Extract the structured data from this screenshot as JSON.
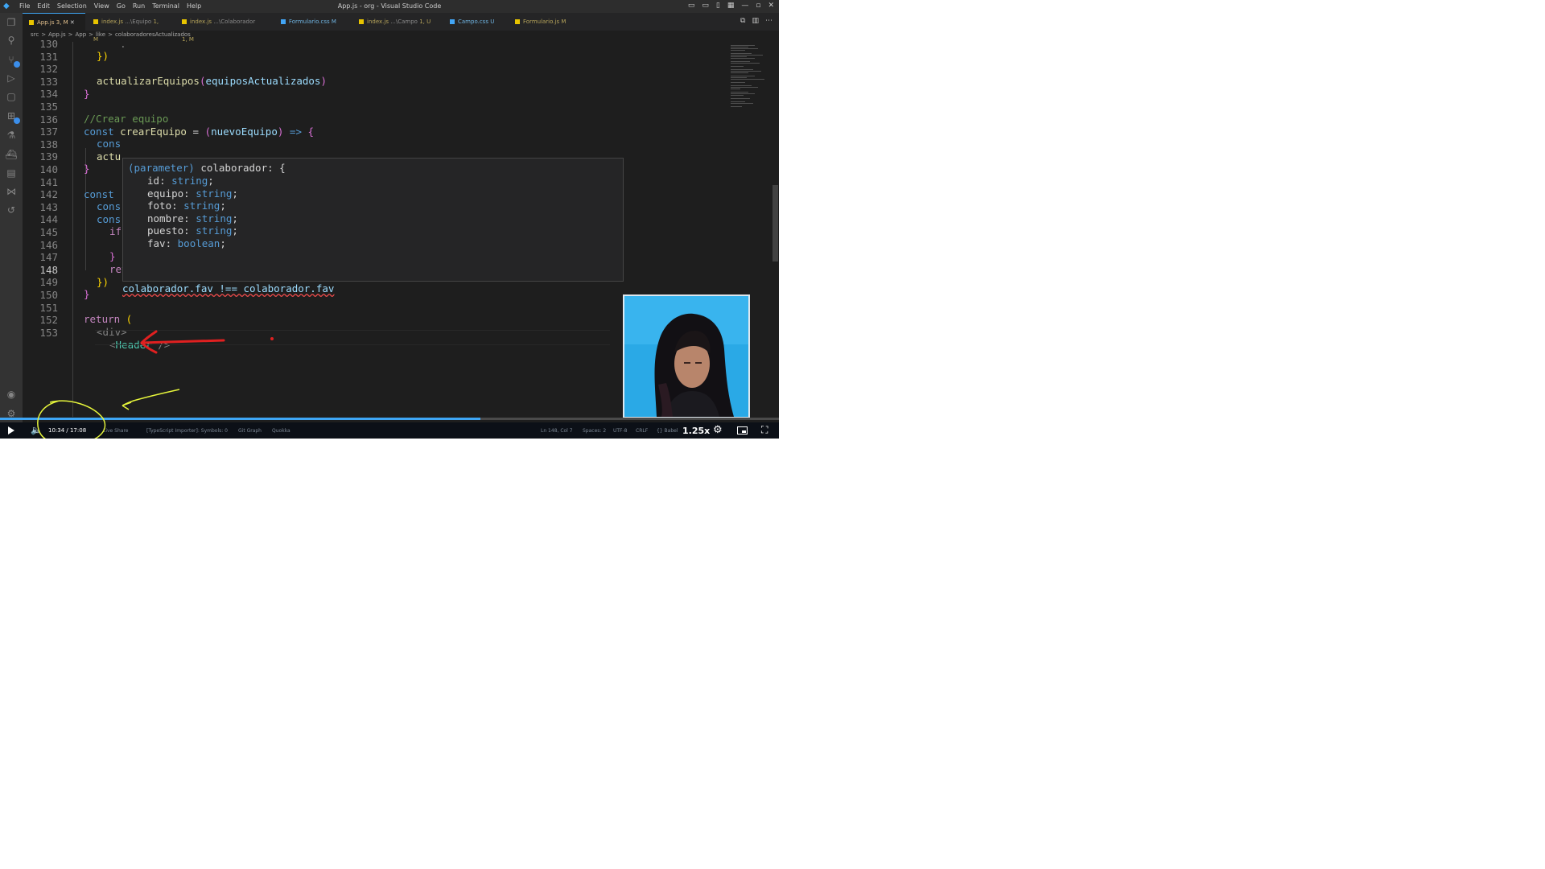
{
  "window": {
    "title": "App.js - org - Visual Studio Code",
    "menu": [
      "File",
      "Edit",
      "Selection",
      "View",
      "Go",
      "Run",
      "Terminal",
      "Help"
    ],
    "controls": [
      "▭",
      "▭",
      "▯",
      "▦",
      "—",
      "▫",
      "✕"
    ]
  },
  "tabs": [
    {
      "name": "App.js",
      "status": "3, M",
      "active": true,
      "close": "✕"
    },
    {
      "name": "index.js",
      "path": "...\\Equipo",
      "status": "1, M"
    },
    {
      "name": "index.js",
      "path": "...\\Colaborador",
      "status": "1, M"
    },
    {
      "name": "Formulario.css",
      "status": "M"
    },
    {
      "name": "index.js",
      "path": "...\\Campo",
      "status": "1, U"
    },
    {
      "name": "Campo.css",
      "status": "U"
    },
    {
      "name": "Formulario.js",
      "status": "M"
    }
  ],
  "breadcrumb": [
    "src",
    ">",
    "App.js",
    ">",
    "App",
    ">",
    "like",
    ">",
    "colaboradoresActualizados"
  ],
  "line_numbers": [
    "130",
    "131",
    "132",
    "133",
    "134",
    "135",
    "136",
    "137",
    "138",
    "139",
    "140",
    "141",
    "142",
    "143",
    "144",
    "145",
    "146",
    "147",
    "148",
    "149",
    "150",
    "151",
    "152",
    "153"
  ],
  "current_line": "148",
  "code": {
    "l131": "})",
    "l132_fn": "actualizarEquipos",
    "l132_paren_open": "(",
    "l132_arg": "equiposActualizados",
    "l132_paren_close": ")",
    "l133": "}",
    "l135": "//Crear equipo",
    "l136_kw": "const",
    "l136_fn": "crearEquipo",
    "l136_eq": " = ",
    "l136_p1": "(",
    "l136_arg": "nuevoEquipo",
    "l136_p2": ")",
    "l136_arrow": " => ",
    "l136_brace": "{",
    "l137": "cons",
    "l138": "actu",
    "l139": "}",
    "l141": "const",
    "l142": "cons",
    "l143": "cons",
    "l144": "if",
    "l146": "}",
    "l147_kw": "return",
    "l147_var": "colaborador",
    "l148": "})",
    "l149": "}",
    "l151_kw": "return",
    "l151_p": " (",
    "l152": "<div>",
    "l153_open": "<",
    "l153_tag": "Header",
    "l153_close": " />"
  },
  "error_line": "colaborador.fav !== colaborador.fav",
  "hover": {
    "header_kw": "(parameter)",
    "header_rest": " colaborador: {",
    "fields": [
      {
        "name": "id",
        "type": "string"
      },
      {
        "name": "equipo",
        "type": "string"
      },
      {
        "name": "foto",
        "type": "string"
      },
      {
        "name": "nombre",
        "type": "string"
      },
      {
        "name": "puesto",
        "type": "string"
      },
      {
        "name": "fav",
        "type": "boolean"
      }
    ],
    "footer": "}"
  },
  "statusbar": {
    "time": "10:34 / 17:08",
    "left_items": [
      "Live Share",
      "[TypeScript Importer]: Symbols: 0",
      "Git Graph",
      "Quokka"
    ],
    "right_items": [
      "Ln 148, Col 7",
      "Spaces: 2",
      "UTF-8",
      "CRLF",
      "{} Babel"
    ],
    "speed": "1.25x"
  },
  "video": {
    "progress": 0.617
  },
  "colors": {
    "accent": "#3ea6f5",
    "annotation_red": "#e02020",
    "annotation_yellow": "#e6f53b"
  }
}
